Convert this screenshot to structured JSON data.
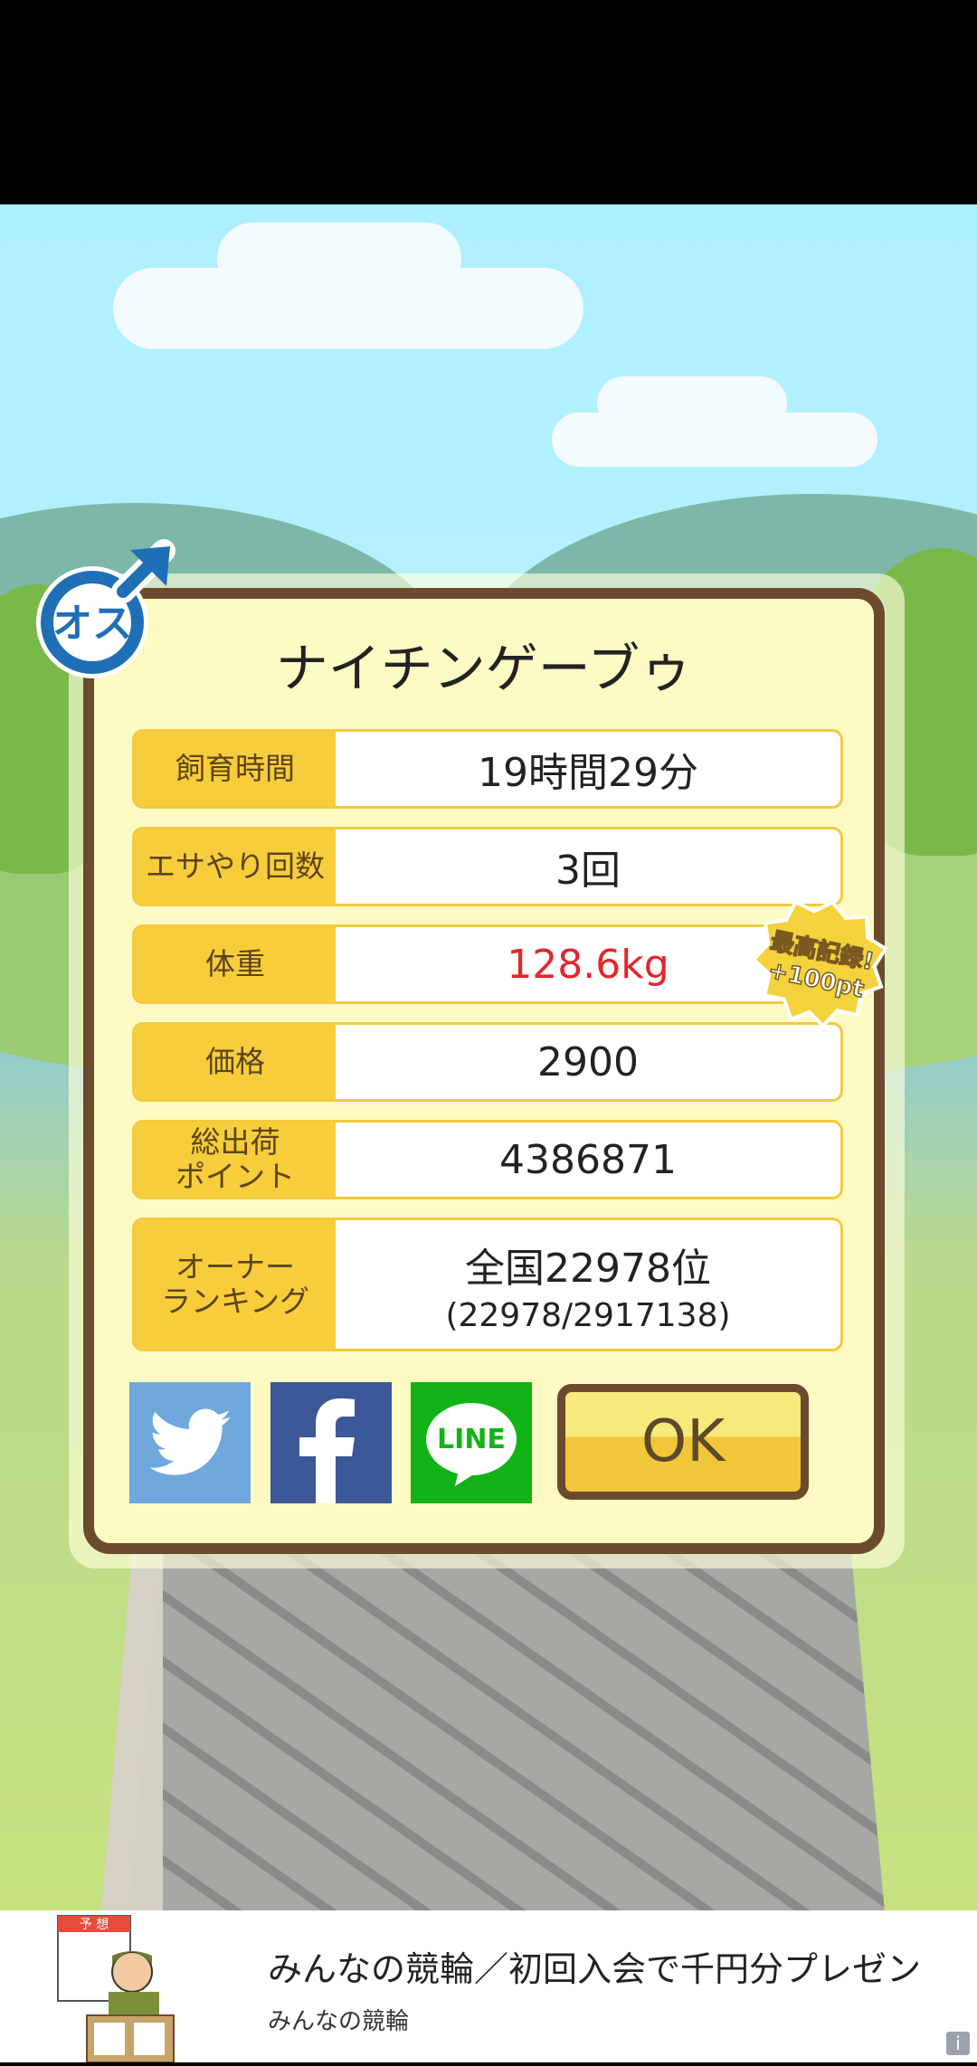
{
  "dialog": {
    "title": "ナイチンゲーブゥ",
    "gender_badge": "オス",
    "record_badge": {
      "line1": "最高記録!",
      "line2": "+100pt"
    },
    "rows": [
      {
        "label": "飼育時間",
        "value": "19時間29分"
      },
      {
        "label": "エサやり回数",
        "value": "3回"
      },
      {
        "label": "体重",
        "value": "128.6kg"
      },
      {
        "label": "価格",
        "value": "2900"
      },
      {
        "label": "総出荷\nポイント",
        "value": "4386871"
      },
      {
        "label": "オーナー\nランキング",
        "value": "全国22978位",
        "sub": "(22978/2917138)"
      }
    ],
    "share": {
      "twitter_icon": "twitter-bird-icon",
      "facebook_icon": "facebook-f-icon",
      "line_label": "LINE"
    },
    "ok_label": "OK",
    "colors": {
      "weight_value": "#e3262a",
      "label_bg": "#f8cd3b",
      "frame": "#6c4a2e",
      "panel": "#fdfbc3"
    }
  },
  "ad": {
    "title": "みんなの競輪／初回入会で千円分プレゼン",
    "subtitle": "みんなの競輪",
    "illustration_text": "予 想",
    "info_label": "i"
  }
}
